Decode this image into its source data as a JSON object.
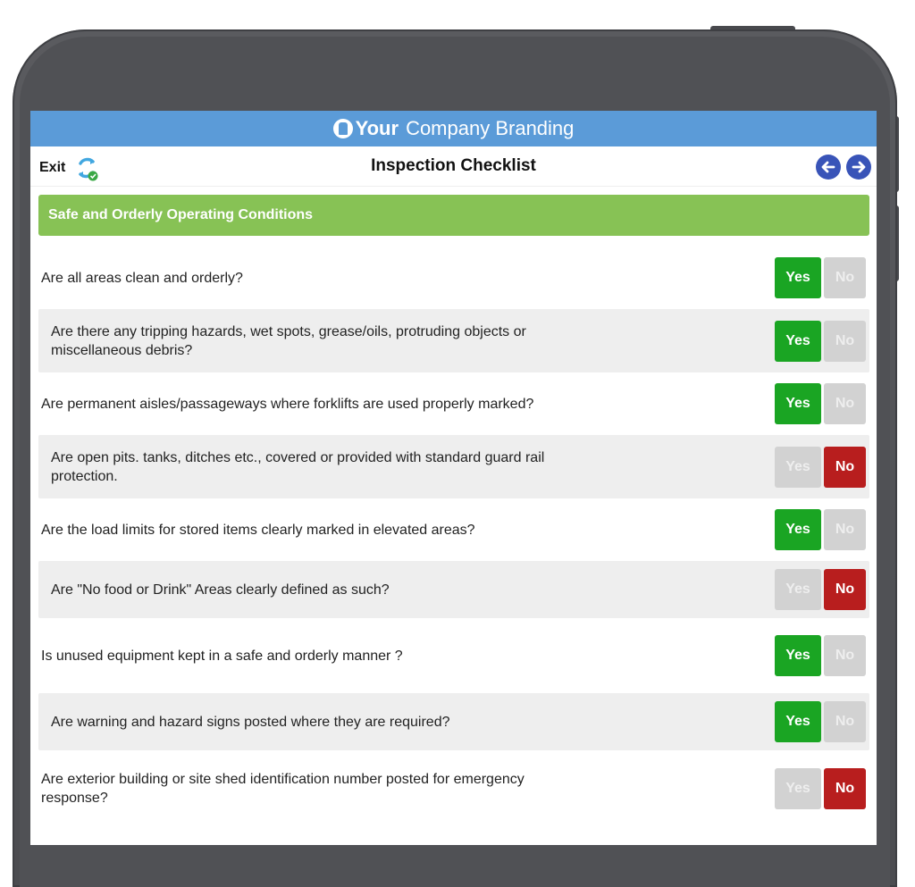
{
  "branding": {
    "strong": "Your",
    "rest": "Company Branding",
    "color": "#5b9bd8"
  },
  "nav": {
    "exit_label": "Exit",
    "title": "Inspection Checklist",
    "sync_icon": "sync-icon",
    "back_icon": "arrow-left-icon",
    "forward_icon": "arrow-right-icon"
  },
  "section": {
    "title": "Safe and Orderly Operating Conditions",
    "color": "#87c255"
  },
  "buttons": {
    "yes_label": "Yes",
    "no_label": "No",
    "yes_active_color": "#1aa523",
    "no_active_color": "#b81e1e",
    "inactive_color": "#d2d2d2"
  },
  "questions": [
    {
      "text": "Are all areas clean and orderly?",
      "answer": "Yes"
    },
    {
      "text": "Are there any tripping hazards, wet spots, grease/oils, protruding objects or miscellaneous debris?",
      "answer": "Yes"
    },
    {
      "text": "Are permanent aisles/passageways where forklifts are used properly marked?",
      "answer": "Yes"
    },
    {
      "text": "Are open pits. tanks, ditches etc., covered or provided with standard guard rail protection.",
      "answer": "No"
    },
    {
      "text": "Are the load limits for stored items clearly marked in elevated areas?",
      "answer": "Yes"
    },
    {
      "text": "Are \"No food or Drink\" Areas clearly defined as such?",
      "answer": "No"
    },
    {
      "text": "Is unused equipment kept in a safe and orderly manner ?",
      "answer": "Yes"
    },
    {
      "text": "Are warning and hazard signs posted where they are required?",
      "answer": "Yes"
    },
    {
      "text": "Are exterior building or site shed identification number posted for emergency response?",
      "answer": "No"
    }
  ]
}
